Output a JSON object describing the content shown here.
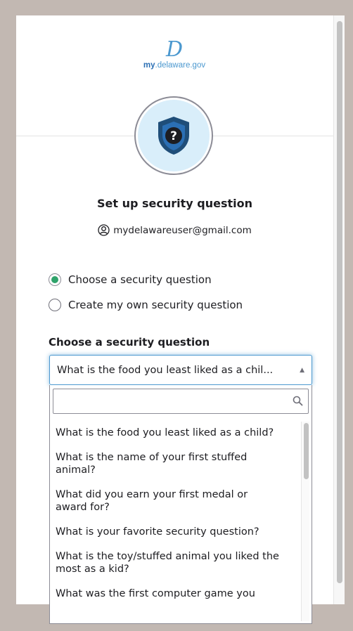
{
  "logo": {
    "glyph": "D",
    "my": "my",
    "rest": ".delaware.gov"
  },
  "page": {
    "title": "Set up security question",
    "user_email": "mydelawareuser@gmail.com"
  },
  "options": {
    "choose_label": "Choose a security question",
    "create_label": "Create my own security question",
    "selected": "choose"
  },
  "question_field": {
    "label": "Choose a security question",
    "selected_value": "What is the food you least liked as a chil...",
    "search_placeholder": "",
    "items": [
      "What is the food you least liked as a child?",
      "What is the name of your first stuffed animal?",
      "What did you earn your first medal or award for?",
      "What is your favorite security question?",
      "What is the toy/stuffed animal you liked the most as a kid?",
      "What was the first computer game you"
    ]
  },
  "colors": {
    "accent": "#4b98cf",
    "brand_dark": "#2b6fb4",
    "radio_selected": "#2fa36b",
    "shield": "#1f4e79"
  }
}
